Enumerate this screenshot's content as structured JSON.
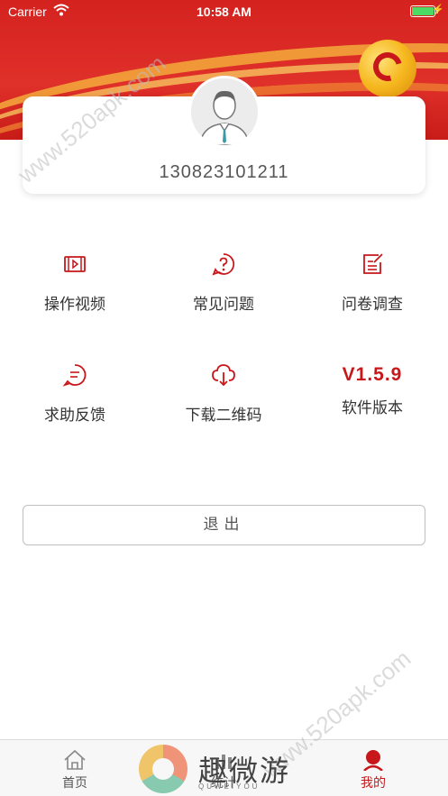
{
  "status_bar": {
    "carrier": "Carrier",
    "time": "10:58 AM"
  },
  "profile": {
    "phone": "130823101211"
  },
  "grid": [
    {
      "label": "操作视频",
      "icon": "video-icon"
    },
    {
      "label": "常见问题",
      "icon": "help-circle-icon"
    },
    {
      "label": "问卷调查",
      "icon": "edit-note-icon"
    },
    {
      "label": "求助反馈",
      "icon": "chat-bubble-icon"
    },
    {
      "label": "下载二维码",
      "icon": "cloud-download-icon"
    }
  ],
  "version": {
    "value": "V1.5.9",
    "label": "软件版本"
  },
  "logout": {
    "label": "退出"
  },
  "tabs": [
    {
      "label": "首页",
      "icon": "home-icon",
      "active": false
    },
    {
      "label": "统计",
      "icon": "stats-icon",
      "active": false
    },
    {
      "label": "我的",
      "icon": "user-icon",
      "active": true
    }
  ],
  "watermark": {
    "text": "www.520apk.com"
  },
  "brand": {
    "name": "趣微游",
    "sub": "QUWEIYOU"
  },
  "colors": {
    "primary_red": "#c8171a",
    "header_red": "#d4231f",
    "text_dark": "#333333"
  }
}
